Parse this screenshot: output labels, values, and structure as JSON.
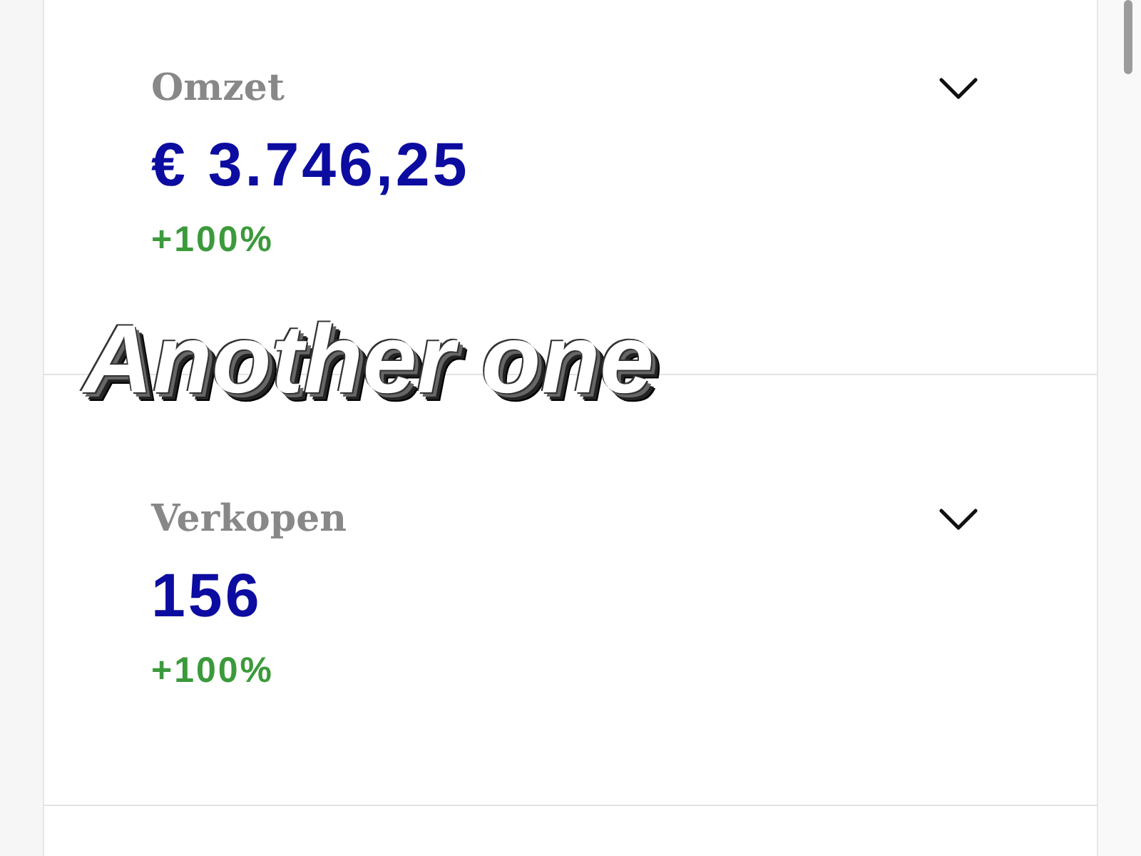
{
  "metrics": [
    {
      "label": "Omzet",
      "value": "€ 3.746,25",
      "change": "+100%",
      "expanded": false
    },
    {
      "label": "Verkopen",
      "value": "156",
      "change": "+100%",
      "expanded": false
    }
  ],
  "overlay_caption": "Another one"
}
